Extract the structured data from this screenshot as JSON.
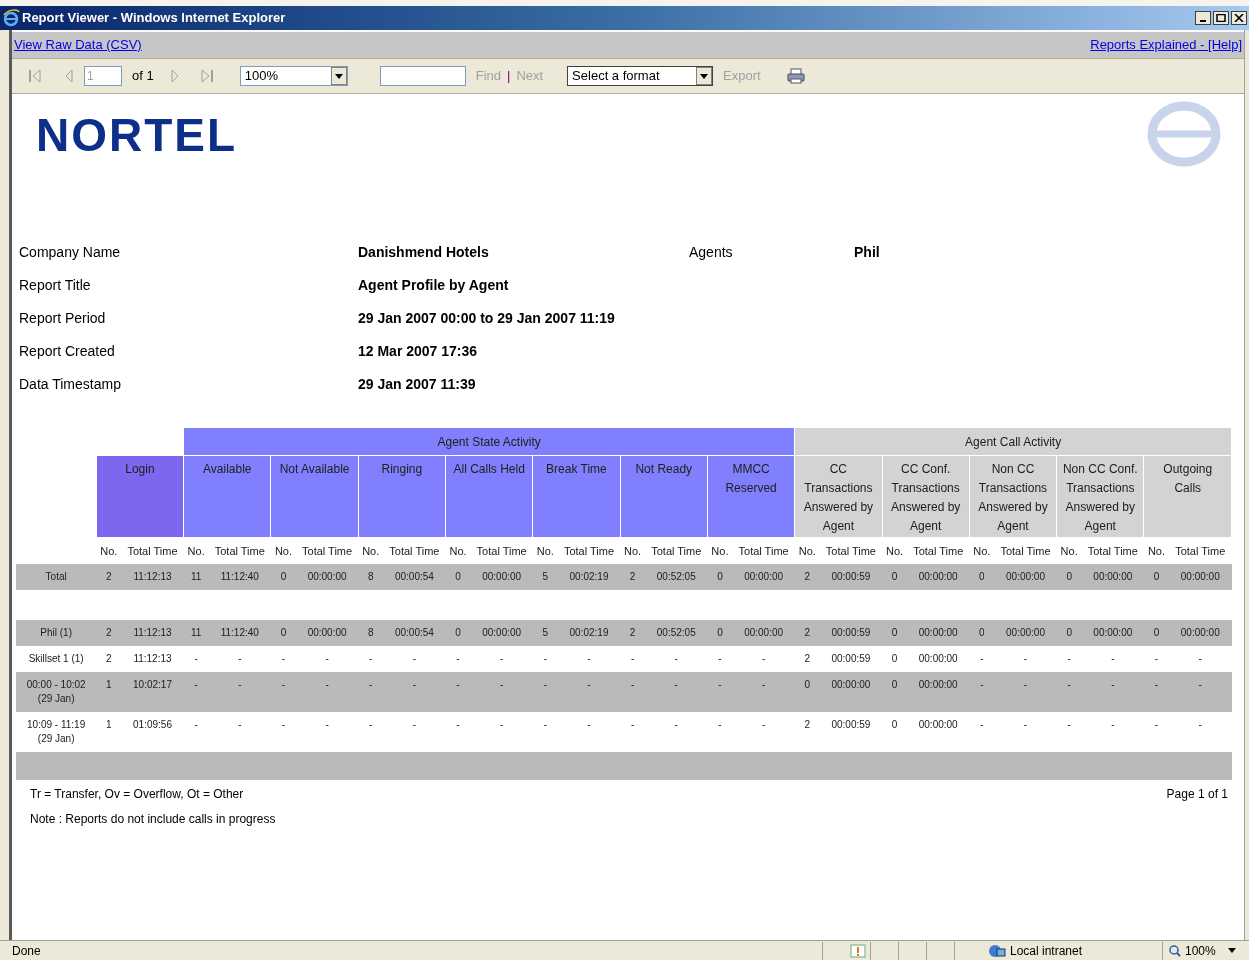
{
  "window": {
    "title": "Report Viewer - Windows Internet Explorer"
  },
  "links": {
    "left": "View Raw Data (CSV)",
    "right": "Reports Explained - [Help]"
  },
  "toolbar": {
    "page": "1",
    "page_count": "of 1",
    "zoom": "100%",
    "find": {
      "label": "Find",
      "disabled": true
    },
    "separator": "|",
    "next": {
      "label": "Next",
      "disabled": true
    },
    "format": "Select a format",
    "export": {
      "label": "Export",
      "disabled": true
    }
  },
  "report": {
    "logo": "NORTEL",
    "info": [
      {
        "label": "Company Name",
        "value": "Danishmend Hotels",
        "extra_label": "Agents",
        "extra_value": "Phil"
      },
      {
        "label": "Report Title",
        "value": "Agent Profile by Agent"
      },
      {
        "label": "Report Period",
        "value": "29 Jan 2007 00:00 to 29 Jan 2007 11:19"
      },
      {
        "label": "Report Created",
        "value": "12 Mar 2007 17:36"
      },
      {
        "label": "Data Timestamp",
        "value": "29 Jan 2007 11:39"
      }
    ],
    "column_groups": [
      {
        "label": "Agent State Activity",
        "kind": "state"
      },
      {
        "label": "Agent Call Activity",
        "kind": "call"
      }
    ],
    "columns": [
      {
        "label": "Login",
        "kind": "login",
        "no_label": "No.",
        "time_label": "Total Time"
      },
      {
        "label": "Available",
        "kind": "state",
        "no_label": "No.",
        "time_label": "Total Time"
      },
      {
        "label": "Not Available",
        "kind": "state",
        "no_label": "No.",
        "time_label": "Total Time"
      },
      {
        "label": "Ringing",
        "kind": "state",
        "no_label": "No.",
        "time_label": "Total Time"
      },
      {
        "label": "All Calls Held",
        "kind": "state",
        "no_label": "No.",
        "time_label": "Total Time"
      },
      {
        "label": "Break Time",
        "kind": "state",
        "no_label": "No.",
        "time_label": "Total Time"
      },
      {
        "label": "Not Ready",
        "kind": "state",
        "no_label": "No.",
        "time_label": "Total Time"
      },
      {
        "label": "MMCC Reserved",
        "kind": "state",
        "no_label": "No.",
        "time_label": "Total Time"
      },
      {
        "label": "CC Transactions Answered by Agent",
        "kind": "call",
        "no_label": "No.",
        "time_label": "Total Time"
      },
      {
        "label": "CC Conf. Transactions Answered by Agent",
        "kind": "call",
        "no_label": "No.",
        "time_label": "Total Time"
      },
      {
        "label": "Non CC Transactions Answered by Agent",
        "kind": "call",
        "no_label": "No.",
        "time_label": "Total Time"
      },
      {
        "label": "Non CC Conf. Transactions Answered by Agent",
        "kind": "call",
        "no_label": "No.",
        "time_label": "Total Time"
      },
      {
        "label": "Outgoing Calls",
        "kind": "call",
        "no_label": "No.",
        "time_label": "Total Time"
      }
    ],
    "rows": [
      {
        "kind": "data",
        "shaded": true,
        "label": "Total",
        "values": [
          "2",
          "11:12:13",
          "11",
          "11:12:40",
          "0",
          "00:00:00",
          "8",
          "00:00:54",
          "0",
          "00:00:00",
          "5",
          "00:02:19",
          "2",
          "00:52:05",
          "0",
          "00:00:00",
          "2",
          "00:00:59",
          "0",
          "00:00:00",
          "0",
          "00:00:00",
          "0",
          "00:00:00",
          "0",
          "00:00:00"
        ]
      },
      {
        "kind": "spacer",
        "shaded": false
      },
      {
        "kind": "data",
        "shaded": true,
        "label": "Phil (1)",
        "values": [
          "2",
          "11:12:13",
          "11",
          "11:12:40",
          "0",
          "00:00:00",
          "8",
          "00:00:54",
          "0",
          "00:00:00",
          "5",
          "00:02:19",
          "2",
          "00:52:05",
          "0",
          "00:00:00",
          "2",
          "00:00:59",
          "0",
          "00:00:00",
          "0",
          "00:00:00",
          "0",
          "00:00:00",
          "0",
          "00:00:00"
        ]
      },
      {
        "kind": "data",
        "shaded": false,
        "label": "Skillset 1 (1)",
        "values": [
          "2",
          "11:12:13",
          "-",
          "-",
          "-",
          "-",
          "-",
          "-",
          "-",
          "-",
          "-",
          "-",
          "-",
          "-",
          "-",
          "-",
          "2",
          "00:00:59",
          "0",
          "00:00:00",
          "-",
          "-",
          "-",
          "-",
          "-",
          "-"
        ]
      },
      {
        "kind": "data",
        "shaded": true,
        "label": "00:00 - 10:02 (29 Jan)",
        "values": [
          "1",
          "10:02:17",
          "-",
          "-",
          "-",
          "-",
          "-",
          "-",
          "-",
          "-",
          "-",
          "-",
          "-",
          "-",
          "-",
          "-",
          "0",
          "00:00:00",
          "0",
          "00:00:00",
          "-",
          "-",
          "-",
          "-",
          "-",
          "-"
        ]
      },
      {
        "kind": "data",
        "shaded": false,
        "label": "10:09 - 11:19 (29 Jan)",
        "values": [
          "1",
          "01:09:56",
          "-",
          "-",
          "-",
          "-",
          "-",
          "-",
          "-",
          "-",
          "-",
          "-",
          "-",
          "-",
          "-",
          "-",
          "2",
          "00:00:59",
          "0",
          "00:00:00",
          "-",
          "-",
          "-",
          "-",
          "-",
          "-"
        ]
      },
      {
        "kind": "spacer",
        "shaded": true
      }
    ],
    "legend": "Tr = Transfer, Ov = Overflow, Ot = Other",
    "page": "Page 1 of 1",
    "note": "Note : Reports do not include calls in progress"
  },
  "status_bar": {
    "text": "Done",
    "zone": "Local intranet",
    "zoom": "100%"
  }
}
